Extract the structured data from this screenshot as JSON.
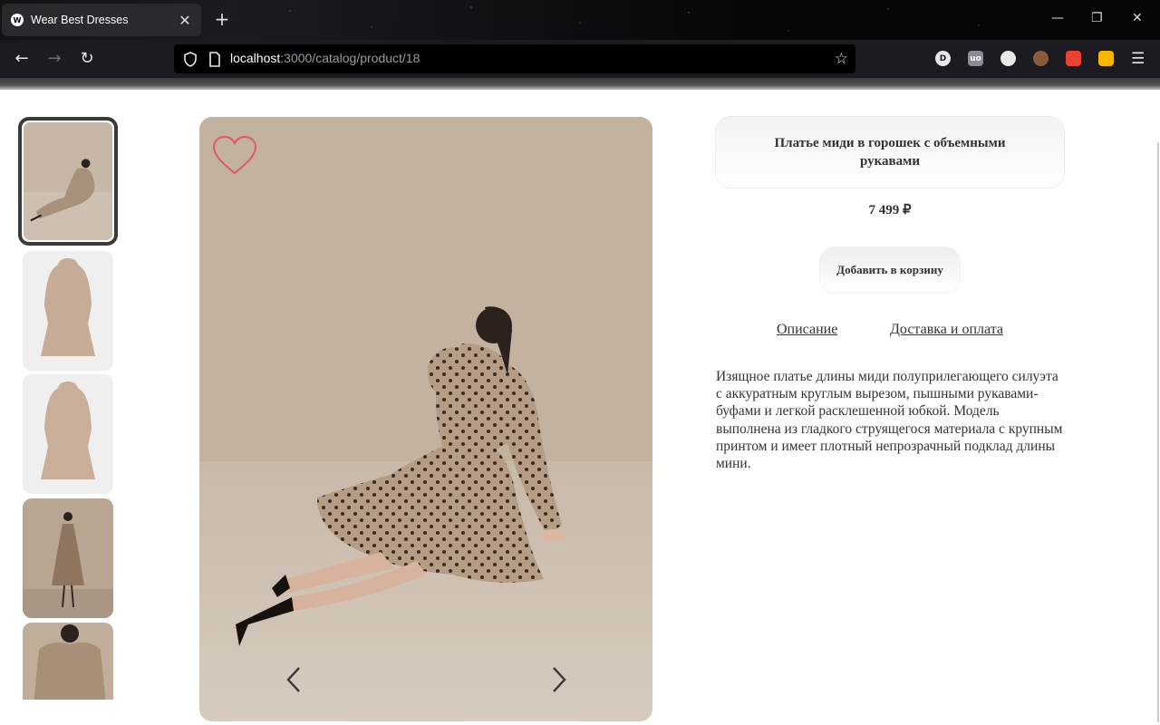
{
  "browser": {
    "tab_title": "Wear Best Dresses",
    "new_tab": "+",
    "url_host": "localhost",
    "url_rest": ":3000/catalog/product/18",
    "window_controls": {
      "minimize": "—",
      "restore": "❐",
      "close": "✕"
    },
    "extensions": [
      {
        "name": "d-icon",
        "label": "D",
        "color": "#e8e8e8"
      },
      {
        "name": "ublock-icon",
        "label": "uo",
        "color": "#8b8b95"
      },
      {
        "name": "lightbulb-icon",
        "label": "",
        "color": "#e8e8e8"
      },
      {
        "name": "cookie-icon",
        "label": "",
        "color": "#8a5a3a"
      },
      {
        "name": "gmail-icon",
        "label": "",
        "color": "#ea4335"
      },
      {
        "name": "keep-icon",
        "label": "",
        "color": "#f7b500"
      }
    ]
  },
  "product": {
    "title": "Платье миди в горошек с объемными рукавами",
    "price": "7 499 ₽",
    "add_to_cart": "Добавить в корзину",
    "tabs": {
      "description": "Описание",
      "delivery": "Доставка и оплата"
    },
    "description": "Изящное платье длины миди полуприлегающего силуэта с аккуратным круглым вырезом, пышными рукавами-буфами и легкой расклешенной юбкой. Модель выполнена из гладкого струящегося материала с крупным принтом и имеет плотный непрозрачный подклад длины мини."
  },
  "colors": {
    "heart": "#e0576a",
    "photo_bg": "#c4b3a1",
    "dress": "#b49d84",
    "dots": "#3a2b22",
    "text": "#333333"
  }
}
